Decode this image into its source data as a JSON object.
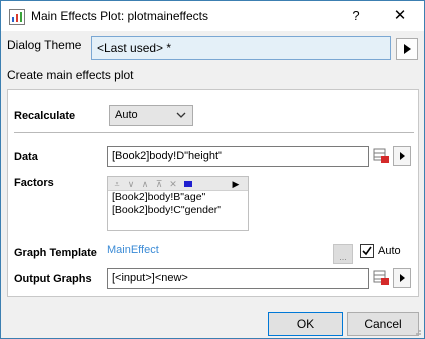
{
  "window": {
    "title": "Main Effects Plot: plotmaineffects"
  },
  "titlebar": {
    "help_label": "?",
    "close_label": "✕"
  },
  "theme": {
    "label": "Dialog Theme",
    "value": "<Last used> *"
  },
  "description": "Create main effects plot",
  "recalculate": {
    "label": "Recalculate",
    "value": "Auto"
  },
  "data_field": {
    "label": "Data",
    "value": "[Book2]body!D\"height\""
  },
  "factors": {
    "label": "Factors",
    "items": [
      "[Book2]body!B\"age\"",
      "[Book2]body!C\"gender\""
    ]
  },
  "graph_template": {
    "label": "Graph Template",
    "link": "MainEffect",
    "dots_label": "...",
    "auto_label": "Auto",
    "auto_checked": true
  },
  "output_graphs": {
    "label": "Output Graphs",
    "value": "[<input>]<new>"
  },
  "buttons": {
    "ok": "OK",
    "cancel": "Cancel"
  }
}
